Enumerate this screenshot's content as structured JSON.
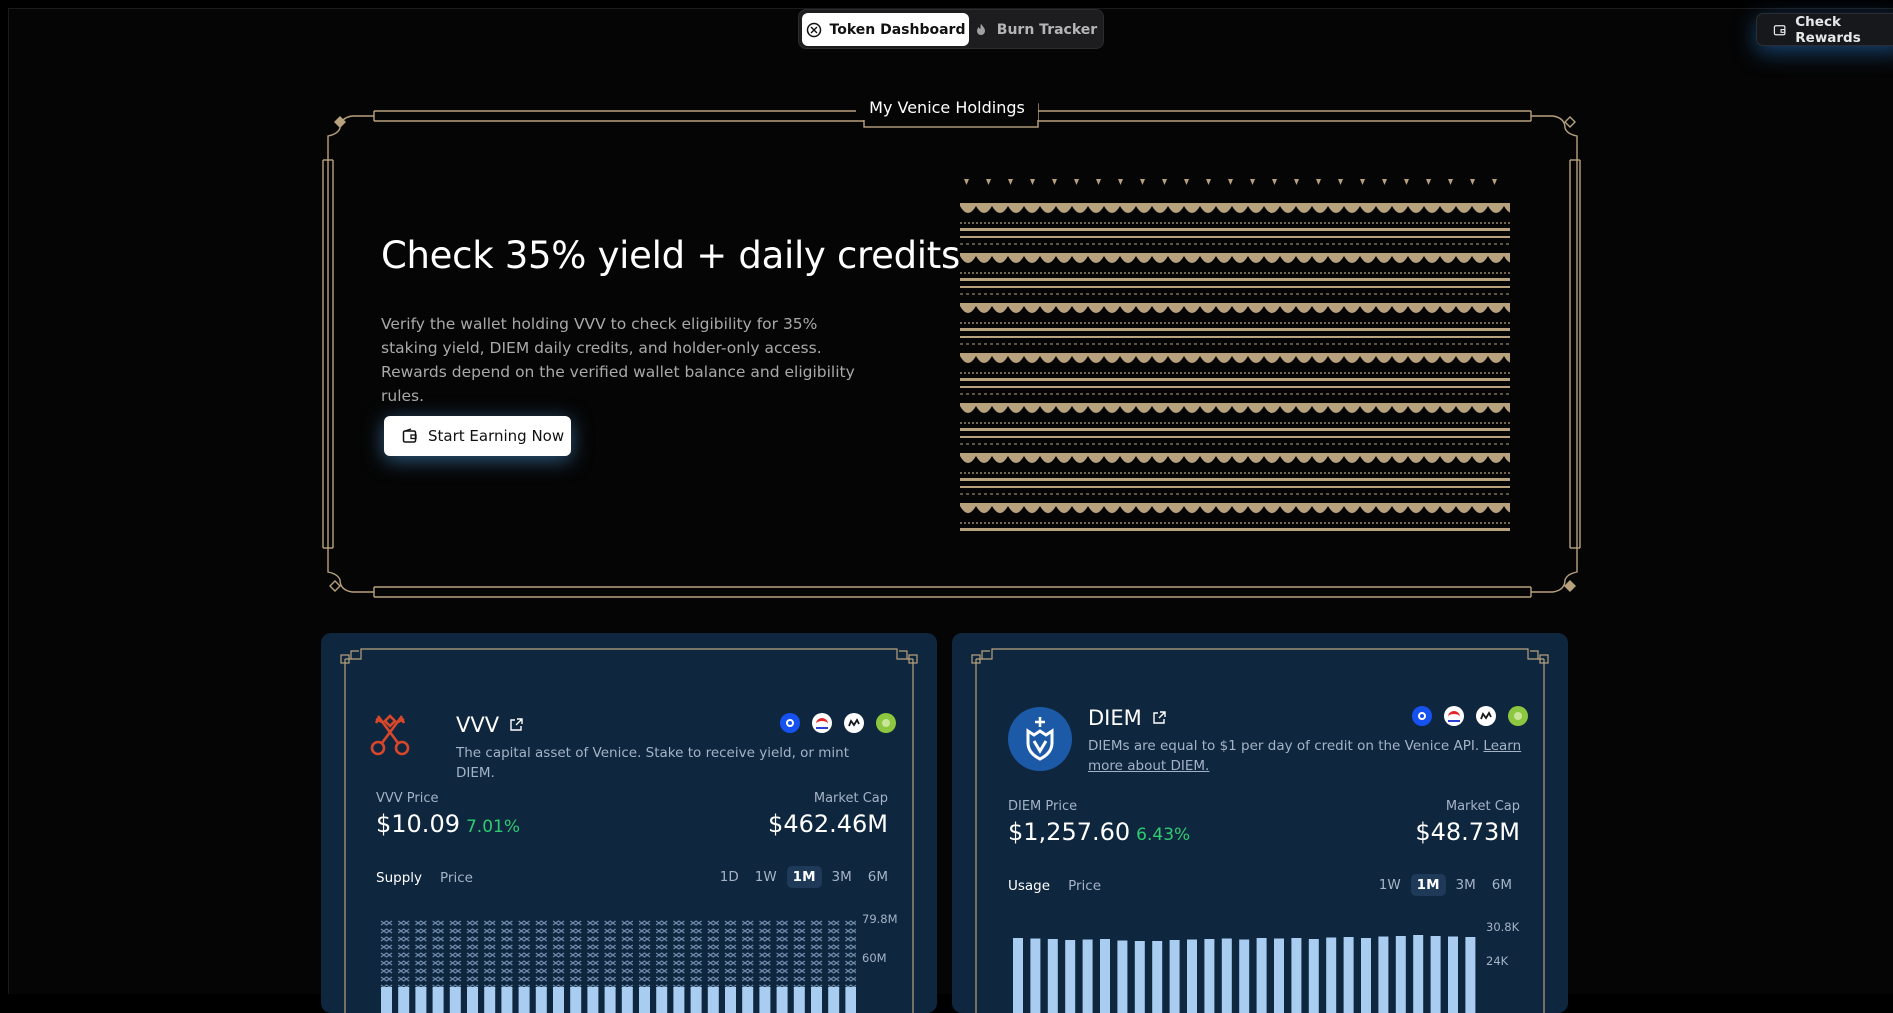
{
  "nav": {
    "tabs": [
      {
        "label": "Token Dashboard",
        "active": true,
        "icon": "token-icon"
      },
      {
        "label": "Burn Tracker",
        "active": false,
        "icon": "flame-icon"
      }
    ],
    "check_rewards": "Check Rewards"
  },
  "hero": {
    "section_label": "My Venice Holdings",
    "title": "Check 35% yield + daily credits",
    "description": "Verify the wallet holding VVV to check eligibility for 35% staking yield, DIEM daily credits, and holder-only access. Rewards depend on the verified wallet balance and eligibility rules.",
    "cta": "Start Earning Now"
  },
  "cards": {
    "vvv": {
      "name": "VVV",
      "description": "The capital asset of Venice. Stake to receive yield, or mint DIEM.",
      "price_label": "VVV Price",
      "price": "$10.09",
      "change": "7.01%",
      "mcap_label": "Market Cap",
      "mcap": "$462.46M",
      "chart_tabs": [
        "Supply",
        "Price"
      ],
      "ranges": [
        "1D",
        "1W",
        "1M",
        "3M",
        "6M"
      ],
      "active_range": "1M",
      "axis": [
        "79.8M",
        "60M"
      ],
      "link_icons": [
        "coinbase-icon",
        "base-bridge-icon",
        "coinmarketcap-icon",
        "coingecko-icon"
      ]
    },
    "diem": {
      "name": "DIEM",
      "description": "DIEMs are equal to $1 per day of credit on the Venice API.",
      "learn_more": "Learn more about DIEM.",
      "price_label": "DIEM Price",
      "price": "$1,257.60",
      "change": "6.43%",
      "mcap_label": "Market Cap",
      "mcap": "$48.73M",
      "chart_tabs": [
        "Usage",
        "Price"
      ],
      "ranges": [
        "1W",
        "1M",
        "3M",
        "6M"
      ],
      "active_range": "1M",
      "axis": [
        "30.8K",
        "24K"
      ],
      "usage_bars": [
        28.6,
        28.5,
        28.4,
        28.2,
        28.3,
        28.4,
        28.1,
        28.0,
        28.0,
        28.2,
        28.3,
        28.4,
        28.5,
        28.3,
        28.6,
        28.5,
        28.6,
        28.4,
        28.7,
        28.8,
        28.6,
        28.9,
        29.0,
        29.2,
        29.0,
        28.9,
        28.8
      ]
    }
  },
  "colors": {
    "gold": "#b8a27e",
    "card_bg": "#0f263f",
    "positive": "#2ecc71",
    "bar": "#a8cdf0"
  }
}
